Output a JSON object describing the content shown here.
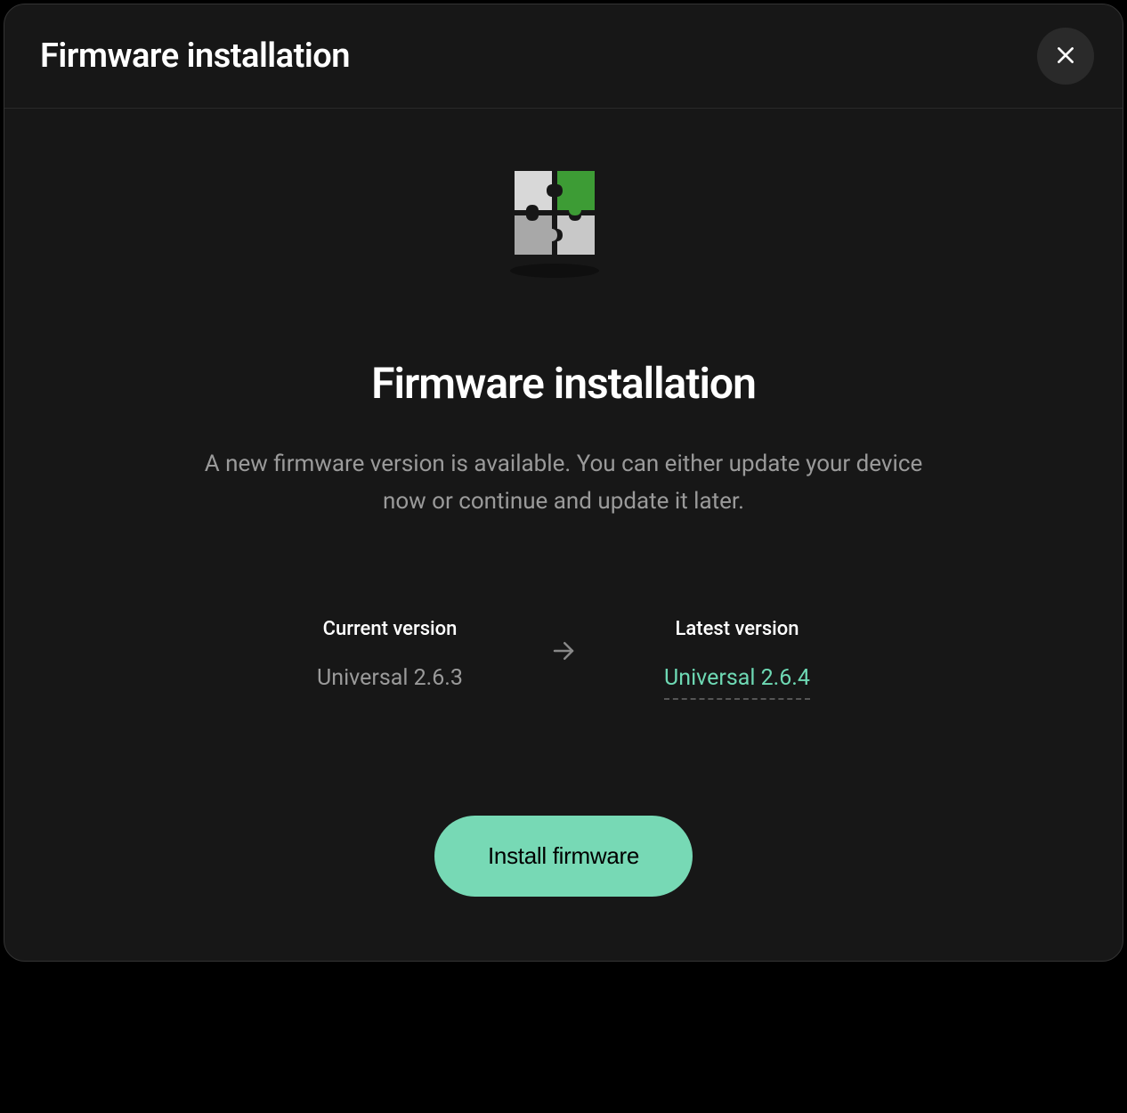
{
  "header": {
    "title": "Firmware installation"
  },
  "content": {
    "title": "Firmware installation",
    "description": "A new firmware version is available. You can either update your device now or continue and update it later."
  },
  "versions": {
    "current": {
      "label": "Current version",
      "value": "Universal 2.6.3"
    },
    "latest": {
      "label": "Latest version",
      "value": "Universal 2.6.4"
    }
  },
  "actions": {
    "install_label": "Install firmware"
  }
}
